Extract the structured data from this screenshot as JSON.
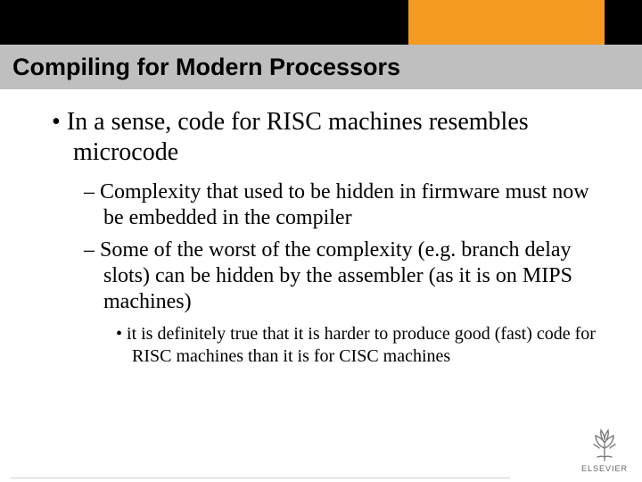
{
  "title": "Compiling for Modern Processors",
  "bullets": {
    "l1": "In a sense, code for RISC machines resembles microcode",
    "l2a": "Complexity that used to be hidden in firmware must now be embedded in the compiler",
    "l2b": "Some of the worst of the complexity (e.g. branch delay slots) can be hidden by the assembler (as it is on MIPS machines)",
    "l3": "it is definitely true that it is harder to produce good (fast) code for RISC machines than it is for CISC machines"
  },
  "publisher": "ELSEVIER",
  "colors": {
    "accent": "#f59a22",
    "bar": "#bfbfbf"
  }
}
